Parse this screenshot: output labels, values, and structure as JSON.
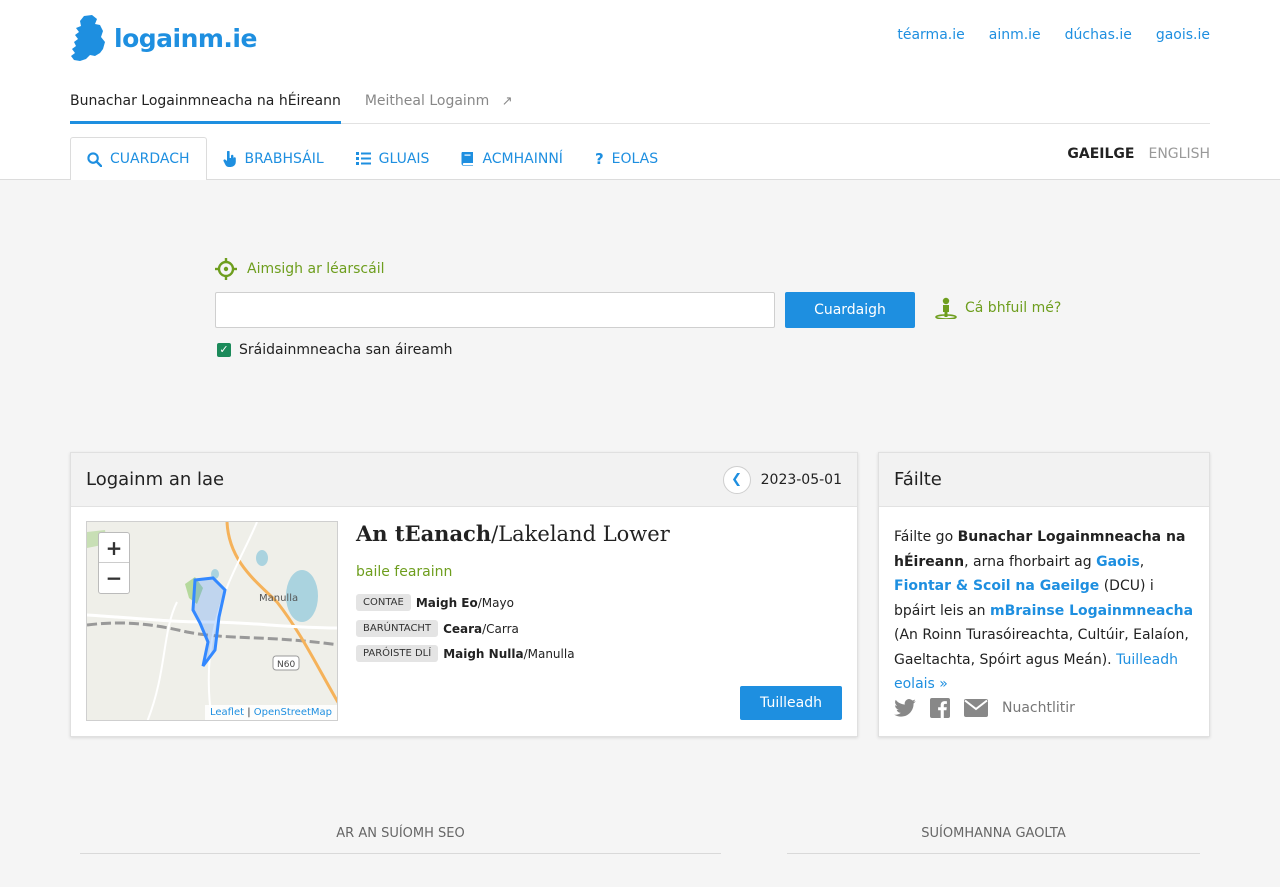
{
  "header": {
    "logo_text": "logainm.ie",
    "ext_links": [
      "téarma.ie",
      "ainm.ie",
      "dúchas.ie",
      "gaois.ie"
    ]
  },
  "subnav": {
    "active": "Bunachar Logainmneacha na hÉireann",
    "other": "Meitheal Logainm"
  },
  "mainnav": {
    "tabs": [
      {
        "label": "CUARDACH",
        "icon": "search-icon"
      },
      {
        "label": "BRABHSÁIL",
        "icon": "pointer-hand-icon"
      },
      {
        "label": "GLUAIS",
        "icon": "list-icon"
      },
      {
        "label": "ACMHAINNÍ",
        "icon": "book-icon"
      },
      {
        "label": "EOLAS",
        "icon": "question-icon"
      }
    ],
    "lang_active": "GAEILGE",
    "lang_other": "ENGLISH"
  },
  "search": {
    "map_link": "Aimsigh ar léarscáil",
    "input_value": "",
    "button": "Cuardaigh",
    "where": "Cá bhfuil mé?",
    "checkbox_label": "Sráidainmneacha san áireamh",
    "checkbox_checked": true
  },
  "place_of_day": {
    "heading": "Logainm an lae",
    "date": "2023-05-01",
    "name_ga": "An tEanach",
    "name_en": "/Lakeland Lower",
    "type": "baile fearainn",
    "meta": [
      {
        "label": "CONTAE",
        "ga": "Maigh Eo",
        "en": "/Mayo"
      },
      {
        "label": "BARÚNTACHT",
        "ga": "Ceara",
        "en": "/Carra"
      },
      {
        "label": "PARÓISTE DLÍ",
        "ga": "Maigh Nulla",
        "en": "/Manulla"
      }
    ],
    "more_button": "Tuilleadh",
    "map": {
      "town_label": "Manulla",
      "road_label": "N60",
      "attribution_1": "Leaflet",
      "attribution_sep": " | ",
      "attribution_2": "OpenStreetMap"
    }
  },
  "welcome": {
    "heading": "Fáilte",
    "t1": "Fáilte go ",
    "b1": "Bunachar Logainmneacha na hÉireann",
    "t2": ", arna fhorbairt ag ",
    "l1": "Gaois",
    "t3": ", ",
    "l2": "Fiontar & Scoil na Gaeilge",
    "t4": " (DCU) i bpáirt leis an ",
    "l3": "mBrainse Logainmneacha",
    "t5": " (An Roinn Turasóireachta, Cultúir, Ealaíon, Gaeltachta, Spóirt agus Meán). ",
    "l4": "Tuilleadh eolais »",
    "newsletter": "Nuachtlitir"
  },
  "footer": {
    "col1": "AR AN SUÍOMH SEO",
    "col2": "SUÍOMHANNA GAOLTA"
  },
  "colors": {
    "accent": "#1e8fe0",
    "green": "#6e9e1e"
  }
}
